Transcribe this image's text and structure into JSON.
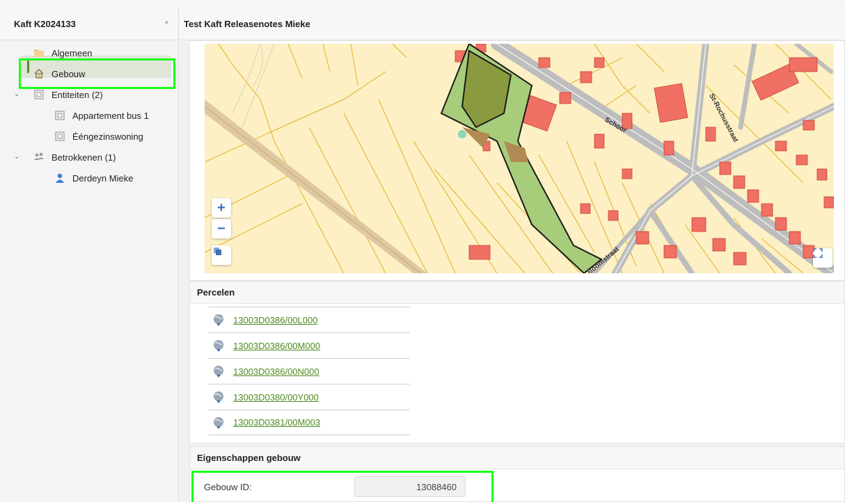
{
  "sidebar": {
    "title": "Kaft K2024133",
    "items": [
      {
        "label": "Algemeen"
      },
      {
        "label": "Gebouw"
      },
      {
        "label": "Entiteiten (2)"
      },
      {
        "label": "Appartement bus 1"
      },
      {
        "label": "Ééngezinswoning"
      },
      {
        "label": "Betrokkenen (1)"
      },
      {
        "label": "Derdeyn Mieke"
      }
    ]
  },
  "main": {
    "title": "Test Kaft Releasenotes Mieke",
    "map": {
      "street_labels": [
        "Schoor",
        "St-Rochusstraat",
        "Boomstraat"
      ],
      "zoom_in": "+",
      "zoom_out": "−"
    },
    "parcels": {
      "title": "Percelen",
      "items": [
        "13003D0386/00L000",
        "13003D0386/00M000",
        "13003D0386/00N000",
        "13003D0380/00Y000",
        "13003D0381/00M003"
      ]
    },
    "properties": {
      "title": "Eigenschappen gebouw",
      "gebouw_id_label": "Gebouw ID:",
      "gebouw_id_value": "13088460"
    }
  },
  "colors": {
    "accent_green": "#5b8a2b",
    "link_green": "#4c8a1e",
    "highlight": "#1aff1a",
    "map_base": "#fcf0c4",
    "building_red": "#f07064",
    "road_gray": "#bdbdbd"
  }
}
